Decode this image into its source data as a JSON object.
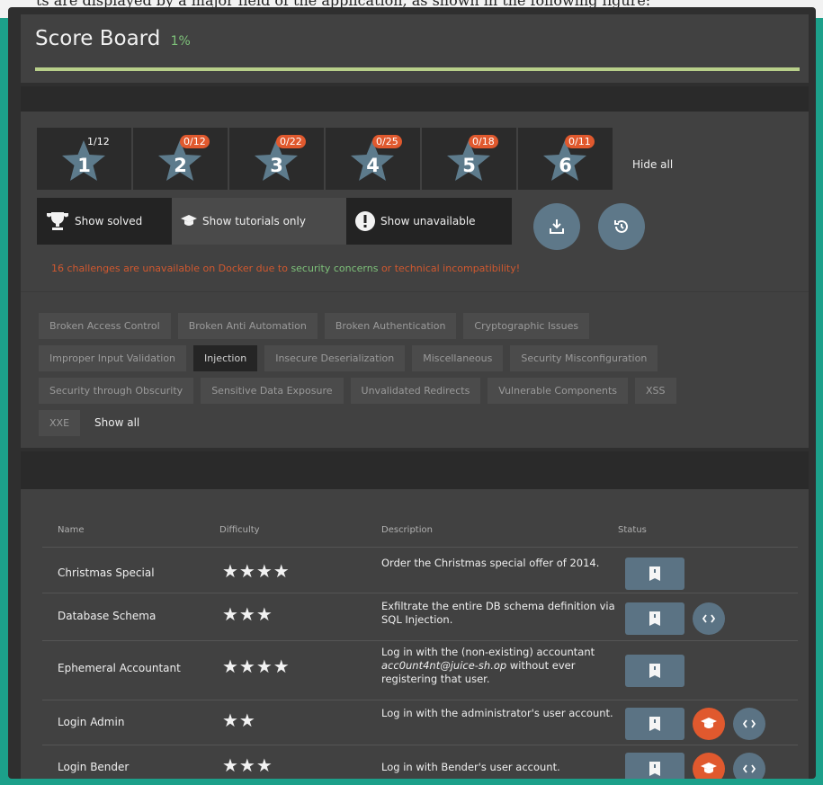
{
  "browser_strip": {
    "text": "ts are displayed by a major field of the application, as shown in the following figure:"
  },
  "header": {
    "title": "Score Board",
    "percent": "1%",
    "progress_fraction": 0.01
  },
  "difficulty_filters": [
    {
      "level": "1",
      "badge": "1/12"
    },
    {
      "level": "2",
      "badge": "0/12"
    },
    {
      "level": "3",
      "badge": "0/22"
    },
    {
      "level": "4",
      "badge": "0/25"
    },
    {
      "level": "5",
      "badge": "0/18"
    },
    {
      "level": "6",
      "badge": "0/11"
    }
  ],
  "hide_all": "Hide all",
  "toggles": {
    "show_solved": "Show solved",
    "show_tutorials": "Show tutorials only",
    "show_unavailable": "Show unavailable"
  },
  "warning": {
    "part1": "16 challenges are unavailable on Docker due to",
    "link": "security concerns",
    "part2": "or technical incompatibility!"
  },
  "categories": {
    "row1": [
      "Broken Access Control",
      "Broken Anti Automation",
      "Broken Authentication",
      "Cryptographic Issues"
    ],
    "row2": [
      "Improper Input Validation",
      "Injection",
      "Insecure Deserialization",
      "Miscellaneous",
      "Security Misconfiguration"
    ],
    "row3": [
      "Security through Obscurity",
      "Sensitive Data Exposure",
      "Unvalidated Redirects",
      "Vulnerable Components",
      "XSS"
    ],
    "row4": [
      "XXE"
    ],
    "active": "Injection",
    "show_all": "Show all"
  },
  "table": {
    "headers": {
      "name": "Name",
      "difficulty": "Difficulty",
      "description": "Description",
      "status": "Status"
    },
    "rows": [
      {
        "name": "Christmas Special",
        "stars": "★★★★",
        "desc": "Order the Christmas special offer of 2014.",
        "tutorial": false,
        "code": false
      },
      {
        "name": "Database Schema",
        "stars": "★★★",
        "desc": "Exfiltrate the entire DB schema definition via SQL Injection.",
        "tutorial": false,
        "code": true
      },
      {
        "name": "Ephemeral Accountant",
        "stars": "★★★★",
        "desc_pre": "Log in with the (non-existing) accountant ",
        "desc_em": "acc0unt4nt@juice-sh.op",
        "desc_post": " without ever registering that user.",
        "tutorial": false,
        "code": false
      },
      {
        "name": "Login Admin",
        "stars": "★★",
        "desc": "Log in with the administrator's user account.",
        "tutorial": true,
        "code": true
      },
      {
        "name": "Login Bender",
        "stars": "★★★",
        "desc": "Log in with Bender's user account.",
        "tutorial": true,
        "code": true
      }
    ]
  },
  "colors": {
    "accent_green": "#7ec27a",
    "warning_orange": "#e0592e",
    "button_blue": "#5b7384",
    "frame_teal": "#1ca08a"
  }
}
